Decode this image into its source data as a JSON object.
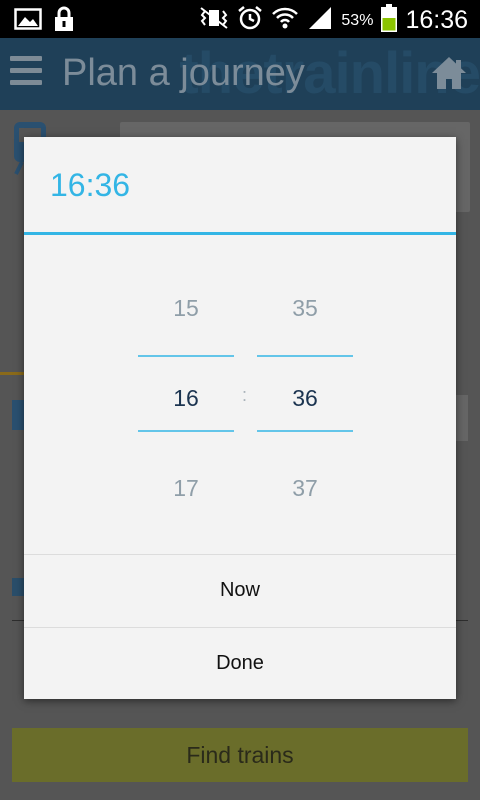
{
  "status_bar": {
    "battery_percent": "53%",
    "time": "16:36",
    "icons": [
      "gallery-icon",
      "lock-icon",
      "vibrate-icon",
      "alarm-icon",
      "wifi-icon",
      "signal-icon",
      "battery-icon"
    ]
  },
  "app_bar": {
    "title": "Plan a journey",
    "watermark": "thetrainline"
  },
  "background": {
    "find_button_label": "Find trains"
  },
  "dialog": {
    "title": "16:36",
    "hours": {
      "prev": "15",
      "current": "16",
      "next": "17"
    },
    "separator": ":",
    "minutes": {
      "prev": "35",
      "current": "36",
      "next": "37"
    },
    "now_label": "Now",
    "done_label": "Done"
  },
  "colors": {
    "accent": "#33b5e5",
    "status_bar": "#000000",
    "battery": "#8bc400"
  }
}
